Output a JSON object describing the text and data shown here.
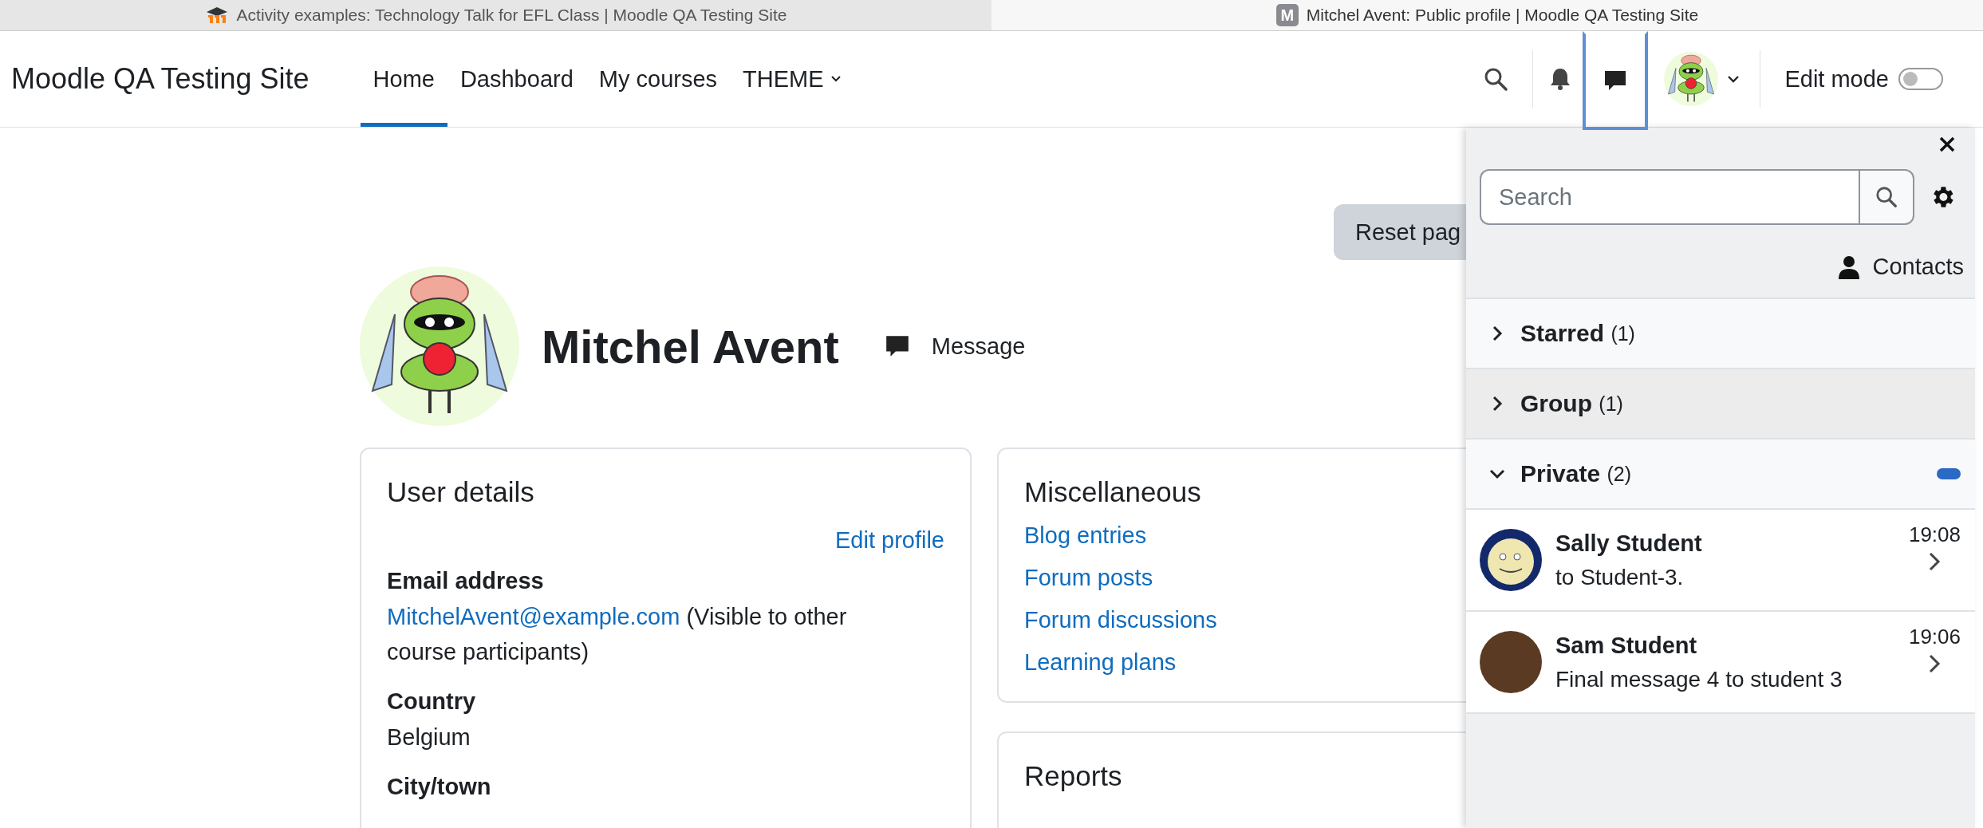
{
  "browser_tabs": [
    {
      "title": "Activity examples: Technology Talk for EFL Class | Moodle QA Testing Site",
      "selected": false,
      "kind": "hat"
    },
    {
      "title": "Mitchel Avent: Public profile | Moodle QA Testing Site",
      "selected": true,
      "kind": "letter",
      "letter": "M"
    }
  ],
  "navbar": {
    "brand": "Moodle QA Testing Site",
    "items": [
      {
        "label": "Home",
        "selected": true,
        "dropdown": false
      },
      {
        "label": "Dashboard",
        "selected": false,
        "dropdown": false
      },
      {
        "label": "My courses",
        "selected": false,
        "dropdown": false
      },
      {
        "label": "THEME",
        "selected": false,
        "dropdown": true
      }
    ],
    "messages_button": {
      "selected": true
    },
    "edit_mode": {
      "label": "Edit mode",
      "on": false
    }
  },
  "page": {
    "reset_button": "Reset pag",
    "user_name": "Mitchel Avent",
    "message_button": "Message",
    "user_details": {
      "title": "User details",
      "edit_link": "Edit profile",
      "fields": [
        {
          "label": "Email address",
          "link": "MitchelAvent@example.com",
          "value": "(Visible to other course participants)"
        },
        {
          "label": "Country",
          "value": "Belgium"
        },
        {
          "label": "City/town"
        }
      ]
    },
    "miscellaneous": {
      "title": "Miscellaneous",
      "links": [
        "Blog entries",
        "Forum posts",
        "Forum discussions",
        "Learning plans"
      ]
    },
    "reports": {
      "title": "Reports"
    }
  },
  "drawer": {
    "search_placeholder": "Search",
    "contacts": "Contacts",
    "sections": [
      {
        "label": "Starred",
        "count": "(1)",
        "expanded": false,
        "selected": false,
        "unread": false
      },
      {
        "label": "Group",
        "count": "(1)",
        "expanded": false,
        "selected": true,
        "unread": false
      },
      {
        "label": "Private",
        "count": "(2)",
        "expanded": true,
        "selected": false,
        "unread": true
      }
    ],
    "conversations": [
      {
        "name": "Sally Student",
        "preview": "to Student-3.",
        "time": "19:08",
        "kind": "cartoon"
      },
      {
        "name": "Sam Student",
        "preview": "Final message 4 to student 3",
        "time": "19:06",
        "kind": "photo"
      }
    ]
  }
}
